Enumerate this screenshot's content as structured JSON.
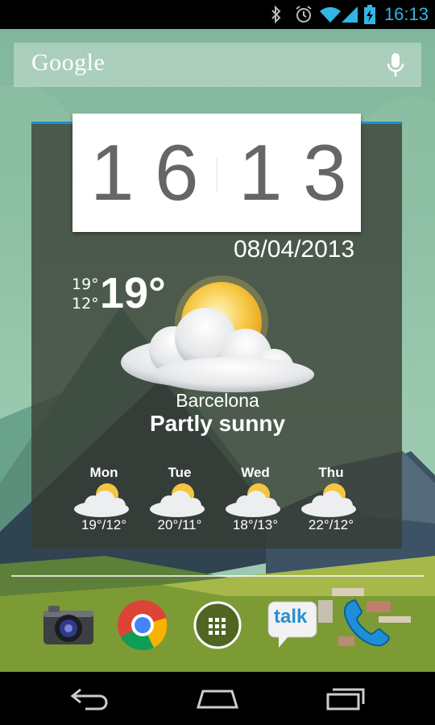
{
  "status_bar": {
    "time": "16:13",
    "icons": [
      "bluetooth-icon",
      "alarm-icon",
      "wifi-icon",
      "signal-icon",
      "battery-charging-icon"
    ],
    "accent_color": "#33b5e5"
  },
  "search_bar": {
    "logo_text": "Google",
    "icon": "mic-icon"
  },
  "widget": {
    "clock": {
      "d1": "1",
      "d2": "6",
      "d3": "1",
      "d4": "3"
    },
    "date": "08/04/2013",
    "temp_high": "19°",
    "temp_low": "12°",
    "temp_current": "19°",
    "city": "Barcelona",
    "condition": "Partly sunny",
    "condition_icon": "partly-sunny-icon",
    "forecast": [
      {
        "day": "Mon",
        "temps": "19°/12°",
        "icon": "partly-sunny-icon"
      },
      {
        "day": "Tue",
        "temps": "20°/11°",
        "icon": "partly-sunny-icon"
      },
      {
        "day": "Wed",
        "temps": "18°/13°",
        "icon": "partly-sunny-icon"
      },
      {
        "day": "Thu",
        "temps": "22°/12°",
        "icon": "partly-sunny-icon"
      }
    ],
    "accent_color": "#1d8fc2"
  },
  "dock": {
    "apps": [
      "camera-icon",
      "chrome-icon",
      "app-drawer-icon",
      "talk-icon",
      "phone-icon"
    ],
    "talk_label": "talk"
  },
  "nav_bar": {
    "buttons": [
      "back-icon",
      "home-icon",
      "recent-apps-icon"
    ]
  }
}
